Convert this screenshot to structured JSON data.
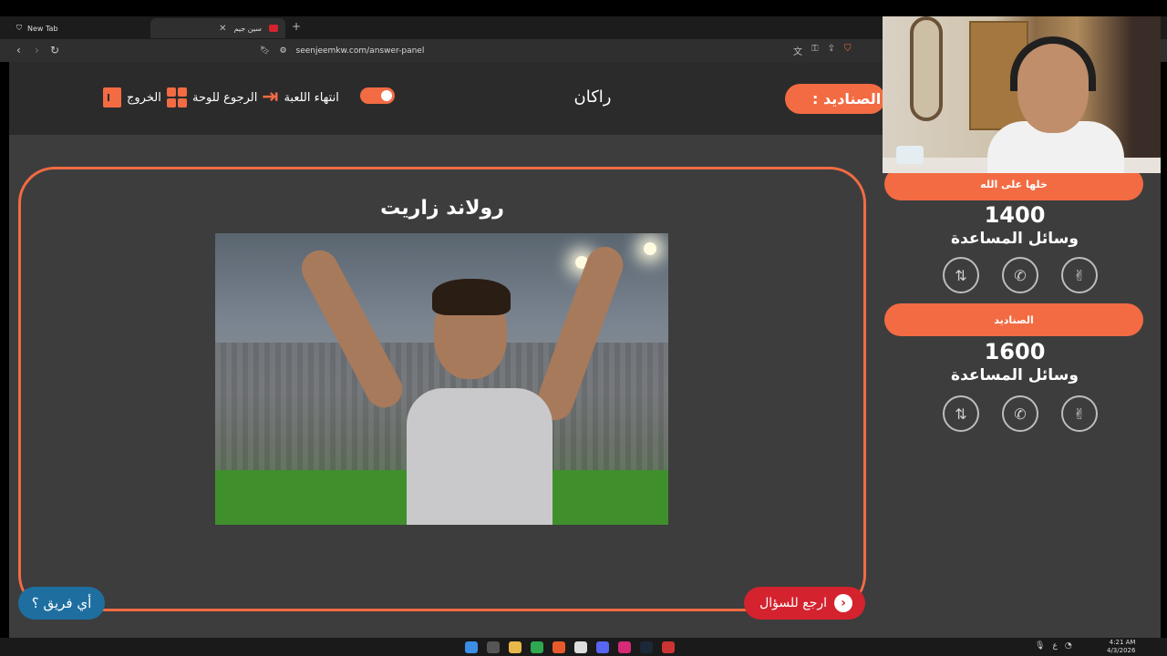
{
  "browser": {
    "tabs": [
      {
        "label": "New Tab",
        "active": false
      },
      {
        "label": "سين جيم",
        "active": true
      }
    ],
    "url": "seenjeemkw.com/answer-panel"
  },
  "header": {
    "exit_label": "الخروج",
    "back_to_board_label": "الرجوع للوحة",
    "end_game_label": "انتهاء اللعبة",
    "current_player": "راكان",
    "current_team_label": ": الصناديد"
  },
  "answer": {
    "title": "رولاند زاريت",
    "back_to_question_label": "ارجع للسؤال",
    "which_team_label": "أي فريق ؟"
  },
  "teams": [
    {
      "name": "خلها على الله",
      "score": "1400",
      "aids_label": "وسائل المساعدة"
    },
    {
      "name": "الصناديد",
      "score": "1600",
      "aids_label": "وسائل المساعدة"
    }
  ],
  "colors": {
    "accent": "#f26b43",
    "panel": "#3d3d3d",
    "header": "#2b2b2b",
    "back_button": "#d4232e",
    "which_team_button": "#1e6fa0"
  },
  "taskbar": {
    "time": "4:21 AM",
    "date": "4/3/2026",
    "lang": "ع"
  }
}
